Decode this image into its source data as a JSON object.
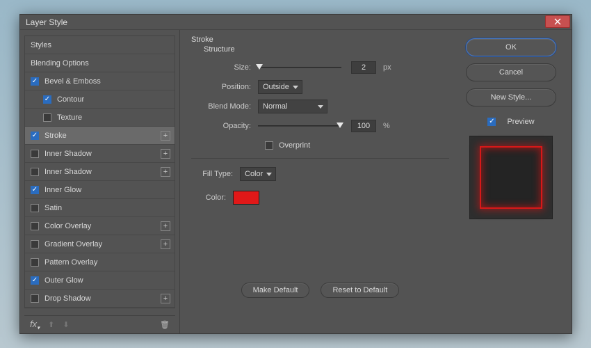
{
  "dialog": {
    "title": "Layer Style"
  },
  "sidebar": {
    "header_styles": "Styles",
    "header_blend": "Blending Options",
    "items": [
      {
        "label": "Bevel & Emboss",
        "checked": true,
        "plus": false
      },
      {
        "label": "Contour",
        "checked": true,
        "plus": false,
        "indent": true
      },
      {
        "label": "Texture",
        "checked": false,
        "plus": false,
        "indent": true
      },
      {
        "label": "Stroke",
        "checked": true,
        "plus": true,
        "selected": true
      },
      {
        "label": "Inner Shadow",
        "checked": false,
        "plus": true
      },
      {
        "label": "Inner Shadow",
        "checked": false,
        "plus": true
      },
      {
        "label": "Inner Glow",
        "checked": true,
        "plus": false
      },
      {
        "label": "Satin",
        "checked": false,
        "plus": false
      },
      {
        "label": "Color Overlay",
        "checked": false,
        "plus": true
      },
      {
        "label": "Gradient Overlay",
        "checked": false,
        "plus": true
      },
      {
        "label": "Pattern Overlay",
        "checked": false,
        "plus": false
      },
      {
        "label": "Outer Glow",
        "checked": true,
        "plus": false
      },
      {
        "label": "Drop Shadow",
        "checked": false,
        "plus": true
      }
    ]
  },
  "stroke": {
    "title": "Stroke",
    "structure": "Structure",
    "size_label": "Size:",
    "size_value": "2",
    "size_unit": "px",
    "position_label": "Position:",
    "position_value": "Outside",
    "blend_label": "Blend Mode:",
    "blend_value": "Normal",
    "opacity_label": "Opacity:",
    "opacity_value": "100",
    "opacity_unit": "%",
    "overprint_label": "Overprint",
    "fill_type_label": "Fill Type:",
    "fill_type_value": "Color",
    "color_label": "Color:",
    "color_hex": "#e01818"
  },
  "buttons": {
    "make_default": "Make Default",
    "reset_default": "Reset to Default",
    "ok": "OK",
    "cancel": "Cancel",
    "new_style": "New Style...",
    "preview": "Preview"
  }
}
